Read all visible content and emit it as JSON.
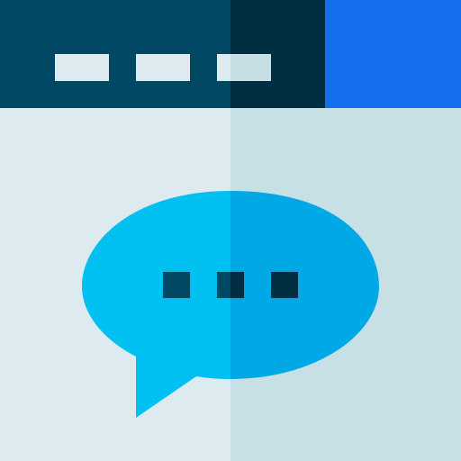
{
  "icon": {
    "name": "chat-window-icon",
    "colors": {
      "titlebar_left": "#004863",
      "titlebar_right": "#002E42",
      "titlebar_accent": "#1570EF",
      "titlebar_dash": "#DDEAEF",
      "titlebar_dash_shaded": "#C6DFE5",
      "window_body_left": "#DDEAEF",
      "window_body_right": "#C6E0E6",
      "bubble_left": "#00C0F2",
      "bubble_right": "#00A8E6",
      "ellipsis_dot_left": "#004863",
      "ellipsis_dot_right": "#002E42"
    }
  }
}
